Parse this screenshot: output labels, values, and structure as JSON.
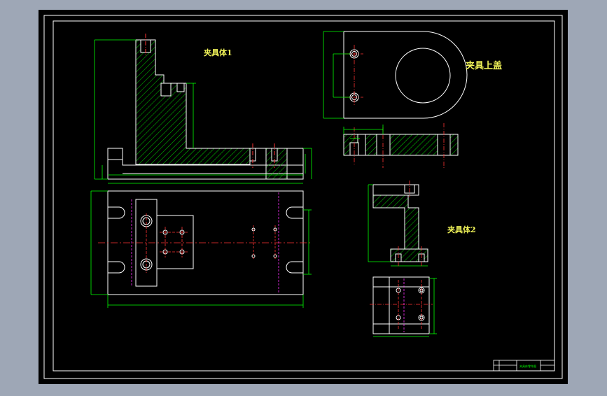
{
  "drawing": {
    "labels": {
      "body1": "夹具体1",
      "cover": "夹具上盖",
      "body2": "夹具体2"
    },
    "title_block": {
      "name": "夹具体零件图"
    },
    "colors": {
      "background": "#000000",
      "frame": "#ffffff",
      "outline": "#ffffff",
      "hatch": "#00ff00",
      "dimension": "#00ff00",
      "center_line": "#ff3333",
      "hidden_line": "#ff00ff",
      "label": "#f4f75a"
    }
  }
}
